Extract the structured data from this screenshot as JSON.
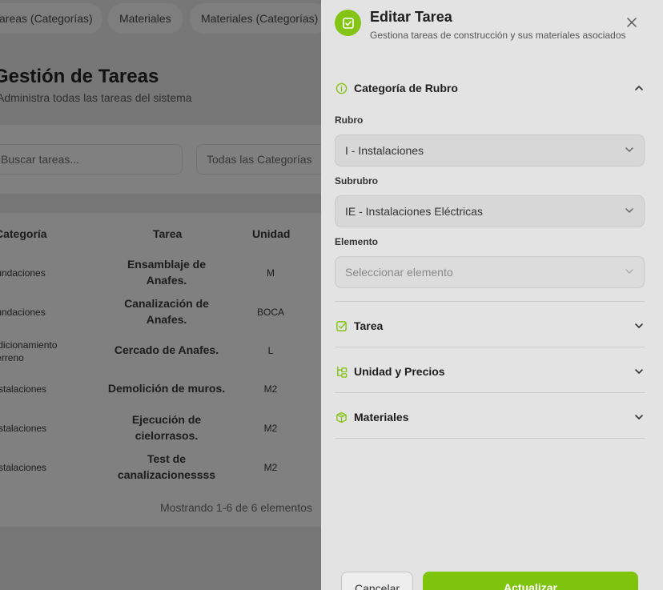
{
  "background": {
    "tabs": [
      "Tareas (Categorías)",
      "Materiales",
      "Materiales (Categorías)"
    ],
    "heading": "Gestión de Tareas",
    "subheading": "Administra todas las tareas del sistema",
    "search_placeholder": "Buscar tareas...",
    "category_filter": "Todas las Categorías",
    "table": {
      "headers": [
        "Categoría",
        "Tarea",
        "Unidad"
      ],
      "rows": [
        {
          "category": "Fundaciones",
          "task": "Ensamblaje de Anafes.",
          "unit": "M"
        },
        {
          "category": "Fundaciones",
          "task": "Canalización de Anafes.",
          "unit": "BOCA"
        },
        {
          "category": "Acondicionamiento del Terreno",
          "task": "Cercado de Anafes.",
          "unit": "L"
        },
        {
          "category": "Instalaciones",
          "task": "Demolición de muros.",
          "unit": "M2"
        },
        {
          "category": "Instalaciones",
          "task": "Ejecución de cielorrasos.",
          "unit": "M2"
        },
        {
          "category": "Instalaciones",
          "task": "Test de canalizacionessss",
          "unit": "M2"
        }
      ]
    },
    "footer": "Mostrando 1-6 de 6 elementos"
  },
  "drawer": {
    "title": "Editar Tarea",
    "subtitle": "Gestiona tareas de construcción y sus materiales asociados",
    "accent_color": "#84c415",
    "sections": {
      "categoria": {
        "label": "Categoría de Rubro",
        "icon": "info-circle-icon",
        "expanded": true
      },
      "tarea": {
        "label": "Tarea",
        "icon": "checkbox-icon",
        "expanded": false
      },
      "unidad": {
        "label": "Unidad y Precios",
        "icon": "tree-structure-icon",
        "expanded": false
      },
      "materiales": {
        "label": "Materiales",
        "icon": "package-icon",
        "expanded": false
      }
    },
    "fields": {
      "rubro": {
        "label": "Rubro",
        "value": "I - Instalaciones"
      },
      "subrubro": {
        "label": "Subrubro",
        "value": "IE - Instalaciones Eléctricas"
      },
      "elemento": {
        "label": "Elemento",
        "placeholder": "Seleccionar elemento"
      }
    },
    "buttons": {
      "cancel": "Cancelar",
      "update": "Actualizar"
    }
  }
}
